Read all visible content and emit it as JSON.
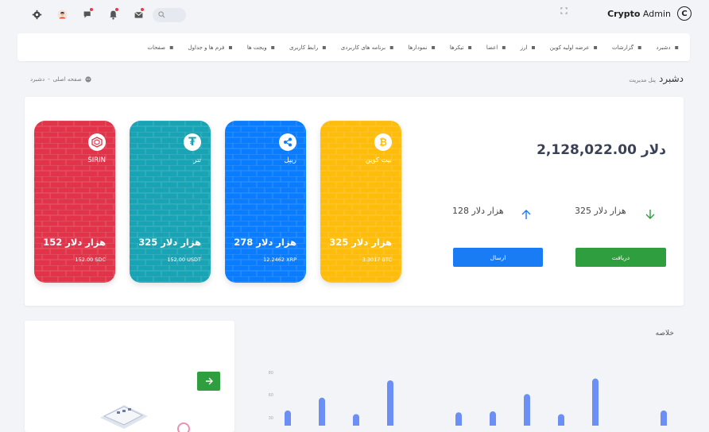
{
  "header": {
    "brand_bold": "Crypto",
    "brand_light": " Admin",
    "brand_logo": "C",
    "icons": [
      "settings-icon",
      "avatar",
      "chat-icon",
      "bell-icon",
      "mail-icon",
      "search-icon"
    ],
    "notification_colors": {
      "chat": "#e63946",
      "bell": "#e63946",
      "mail": "#e63946"
    }
  },
  "menu": {
    "items": [
      {
        "label": "دشبرد",
        "icon": "dashboard-icon"
      },
      {
        "label": "گزارشات",
        "icon": "reports-icon"
      },
      {
        "label": "عرضه اولیه کوین",
        "icon": "ico-icon"
      },
      {
        "label": "ارز",
        "icon": "currency-icon"
      },
      {
        "label": "اعضا",
        "icon": "members-icon"
      },
      {
        "label": "تیکرها",
        "icon": "tickers-icon"
      },
      {
        "label": "نمودارها",
        "icon": "charts-icon"
      },
      {
        "label": "برنامه های کاربردی",
        "icon": "apps-icon"
      },
      {
        "label": "رابط کاربری",
        "icon": "ui-icon"
      },
      {
        "label": "ویجت ها",
        "icon": "widgets-icon"
      },
      {
        "label": "فرم ها و جداول",
        "icon": "forms-icon"
      },
      {
        "label": "صفحات",
        "icon": "pages-icon"
      }
    ]
  },
  "page": {
    "title": "دشبرد",
    "subtitle": "پنل مدیریت",
    "breadcrumb_home": "صفحه اصلی",
    "breadcrumb_sep": "-",
    "breadcrumb_current": "دشبرد"
  },
  "wallet": {
    "total": "2,128,022.00 دلار",
    "received": "325 هزار دلار",
    "sent": "128 هزار دلار",
    "receive_button": "دریافت",
    "send_button": "ارسال"
  },
  "cards": [
    {
      "name": "بیت کوین",
      "amount": "325 هزار دلار",
      "sub": "3.3017 BTC",
      "color": "#ffbd0b",
      "icon": "bitcoin-icon",
      "glyph": "₿"
    },
    {
      "name": "ریپل",
      "amount": "278 هزار دلار",
      "sub": "12.2462 XRP",
      "color": "#0a7cff",
      "icon": "ripple-icon",
      "glyph": ""
    },
    {
      "name": "تتر",
      "amount": "325 هزار دلار",
      "sub": "152.00 USDT",
      "color": "#18a4b4",
      "icon": "tether-icon",
      "glyph": "₮"
    },
    {
      "name": "SIRIN",
      "amount": "152 هزار دلار",
      "sub": "152.00 SDC",
      "color": "#e1344a",
      "icon": "sirin-icon",
      "glyph": ""
    }
  ],
  "summary": {
    "title": "خلاصه"
  },
  "chart_data": {
    "type": "bar",
    "yticks": [
      "80",
      "60",
      "30"
    ],
    "values": [
      34,
      48,
      30,
      67,
      6,
      32,
      33,
      52,
      30,
      69,
      4,
      34
    ],
    "ylim": [
      0,
      100
    ],
    "color": "#6c8ff5"
  }
}
